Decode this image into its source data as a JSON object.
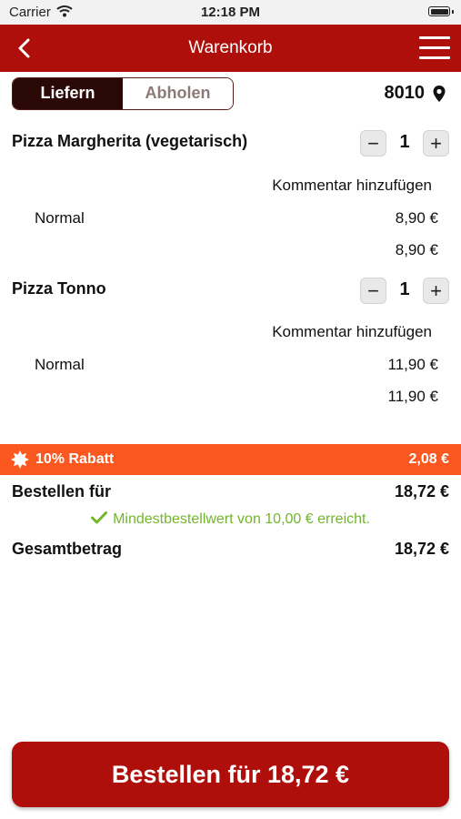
{
  "status_bar": {
    "carrier": "Carrier",
    "time": "12:18 PM"
  },
  "header": {
    "title": "Warenkorb"
  },
  "delivery_mode": {
    "options": [
      "Liefern",
      "Abholen"
    ],
    "selected": "Liefern"
  },
  "postal_code": "8010",
  "cart": {
    "items": [
      {
        "name": "Pizza Margherita (vegetarisch)",
        "quantity": "1",
        "comment_label": "Kommentar hinzufügen",
        "variant": "Normal",
        "variant_price": "8,90 €",
        "line_total": "8,90 €"
      },
      {
        "name": "Pizza Tonno",
        "quantity": "1",
        "comment_label": "Kommentar hinzufügen",
        "variant": "Normal",
        "variant_price": "11,90 €",
        "line_total": "11,90 €"
      }
    ]
  },
  "discount": {
    "label": "10% Rabatt",
    "amount": "2,08 €"
  },
  "summary": {
    "order_for_label": "Bestellen für",
    "order_for_value": "18,72 €",
    "minimum_message": "Mindestbestellwert von 10,00 € erreicht.",
    "total_label": "Gesamtbetrag",
    "total_value": "18,72 €"
  },
  "order_button": {
    "label": "Bestellen für 18,72 €"
  },
  "colors": {
    "brand": "#ae0f0a",
    "discount": "#fb5820",
    "success": "#72b62a",
    "toggle_active": "#2a0806"
  }
}
